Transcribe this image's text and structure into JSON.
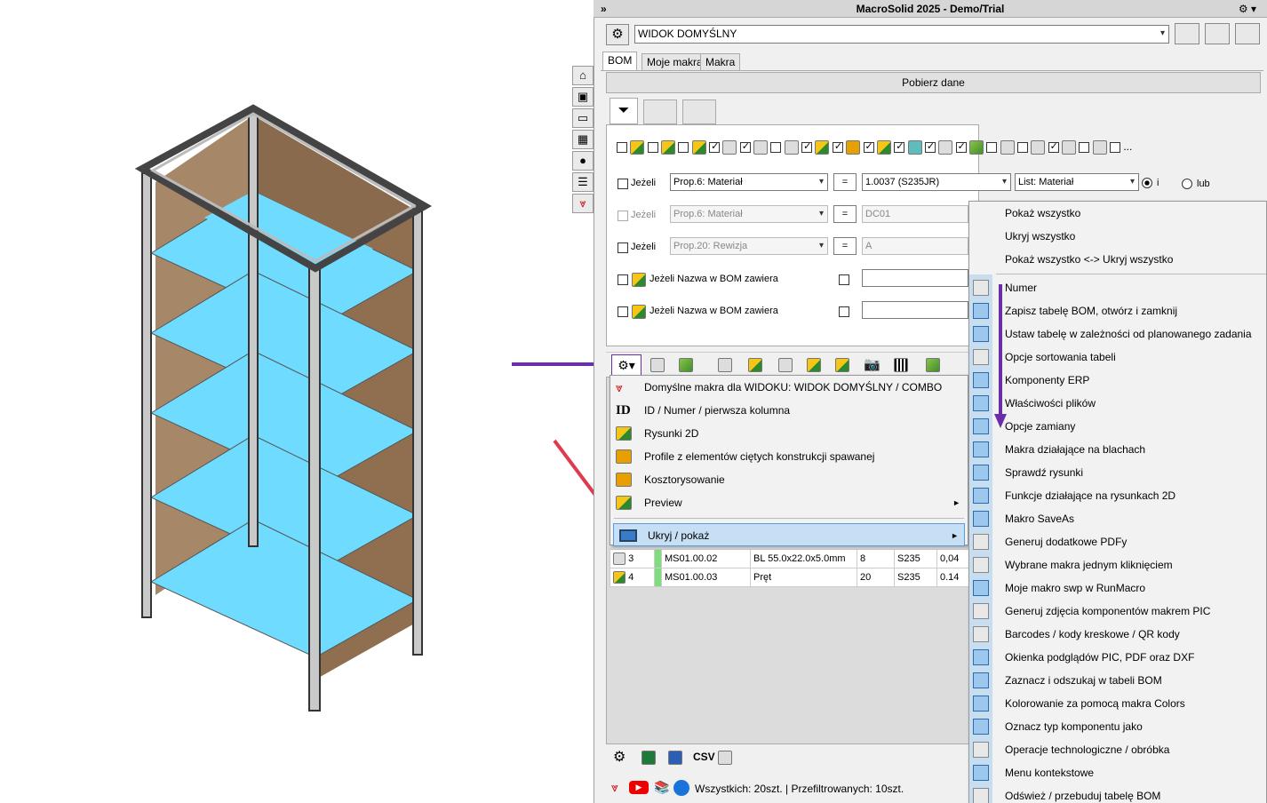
{
  "window": {
    "title": "MacroSolid 2025 - Demo/Trial",
    "collapse_glyph": "»"
  },
  "view_select": {
    "value": "WIDOK DOMYŚLNY"
  },
  "tabs": [
    {
      "label": "BOM"
    },
    {
      "label": "Moje makra"
    },
    {
      "label": "Makra"
    }
  ],
  "fetch_button": {
    "label": "Pobierz dane"
  },
  "filter_rows": [
    {
      "label": "Jeżeli",
      "prop": "Prop.6: Materiał",
      "op": "=",
      "value": "1.0037 (S235JR)",
      "list": "List: Materiał",
      "radio_and": "i",
      "radio_or": "lub",
      "enabled": true
    },
    {
      "label": "Jeżeli",
      "prop": "Prop.6: Materiał",
      "op": "=",
      "value": "DC01",
      "enabled": false
    },
    {
      "label": "Jeżeli",
      "prop": "Prop.20: Rewizja",
      "op": "=",
      "value": "A",
      "enabled": false
    }
  ],
  "name_filters": [
    {
      "label": "Jeżeli Nazwa w BOM zawiera"
    },
    {
      "label": "Jeżeli Nazwa w BOM zawiera"
    }
  ],
  "ellipsis": "...",
  "left_menu": {
    "items": [
      {
        "label": "Domyślne makra dla WIDOKU: WIDOK DOMYŚLNY / COMBO",
        "icon": "chevrons-icon"
      },
      {
        "label": "ID / Numer / pierwsza kolumna",
        "icon": "id-icon",
        "icon_text": "ID"
      },
      {
        "label": "Rysunki 2D",
        "icon": "drawing-icon"
      },
      {
        "label": "Profile z elementów ciętych konstrukcji spawanej",
        "icon": "profile-icon"
      },
      {
        "label": "Kosztorysowanie",
        "icon": "coins-icon"
      },
      {
        "label": "Preview",
        "icon": "preview-icon",
        "submenu": true
      },
      {
        "label": "Ukryj / pokaż",
        "icon": "monitor-icon",
        "submenu": true,
        "highlighted": true
      }
    ],
    "submenu_arrow": "►"
  },
  "right_menu": {
    "top_items": [
      {
        "label": "Pokaż wszystko"
      },
      {
        "label": "Ukryj wszystko"
      },
      {
        "label": "Pokaż wszystko <-> Ukryj wszystko"
      }
    ],
    "items": [
      {
        "label": "Numer",
        "icon": "id-icon",
        "checked": false
      },
      {
        "label": "Zapisz tabelę BOM, otwórz i zamknij",
        "icon": "folder-icon",
        "checked": true
      },
      {
        "label": "Ustaw tabelę w zależności od planowanego zadania",
        "icon": "table-icon",
        "checked": true
      },
      {
        "label": "Opcje sortowania tabeli",
        "icon": "sort-icon",
        "checked": false
      },
      {
        "label": "Komponenty ERP",
        "icon": "erp-icon",
        "checked": true
      },
      {
        "label": "Właściwości plików",
        "icon": "properties-icon",
        "checked": true
      },
      {
        "label": "Opcje zamiany",
        "icon": "replace-icon",
        "checked": true
      },
      {
        "label": "Makra działające na blachach",
        "icon": "sheetmetal-icon",
        "checked": true
      },
      {
        "label": "Sprawdź rysunki",
        "icon": "check-drawing-icon",
        "checked": true
      },
      {
        "label": "Funkcje działające na rysunkach 2D",
        "icon": "drawing-functions-icon",
        "checked": true
      },
      {
        "label": "Makro SaveAs",
        "icon": "saveas-icon",
        "checked": true
      },
      {
        "label": "Generuj dodatkowe PDFy",
        "icon": "pdf-icon",
        "checked": false
      },
      {
        "label": "Wybrane makra jednym kliknięciem",
        "icon": "chevrons-icon",
        "checked": false
      },
      {
        "label": "Moje makro swp w RunMacro",
        "icon": "run-macro-icon",
        "checked": true
      },
      {
        "label": "Generuj zdjęcia komponentów makrem PIC",
        "icon": "camera-icon",
        "checked": false
      },
      {
        "label": "Barcodes / kody kreskowe / QR kody",
        "icon": "qr-icon",
        "checked": false
      },
      {
        "label": "Okienka podglądów PIC, PDF oraz DXF",
        "icon": "preview-icon",
        "checked": true
      },
      {
        "label": "Zaznacz i odszukaj w tabeli BOM",
        "icon": "find-icon",
        "checked": true
      },
      {
        "label": "Kolorowanie za pomocą makra Colors",
        "icon": "colors-icon",
        "checked": true
      },
      {
        "label": "Oznacz typ komponentu jako",
        "icon": "filter-icon",
        "checked": true
      },
      {
        "label": "Operacje technologiczne / obróbka",
        "icon": "operations-icon",
        "checked": false
      },
      {
        "label": "Menu kontekstowe",
        "icon": "check-icon",
        "checked": true
      },
      {
        "label": "Odśwież / przebuduj tabelę BOM",
        "icon": "traffic-light-icon",
        "checked": false
      }
    ]
  },
  "bom_rows": [
    {
      "no": "3",
      "code": "MS01.00.02",
      "name": "BL 55.0x22.0x5.0mm",
      "qty": "8",
      "material": "S235",
      "val": "0,04"
    },
    {
      "no": "4",
      "code": "MS01.00.03",
      "name": "Pręt",
      "qty": "20",
      "material": "S235",
      "val": "0.14"
    }
  ],
  "bottom_toolbar": {
    "csv_label": "CSV"
  },
  "status": {
    "text": "Wszystkich: 20szt. | Przefiltrowanych: 10szt."
  },
  "colors": {
    "highlight": "#c7dff5",
    "arrow_purple": "#6a2fa8",
    "arrow_red": "#e03a4e",
    "shelf": "#6fdcff",
    "wood": "#8a6a4d"
  }
}
